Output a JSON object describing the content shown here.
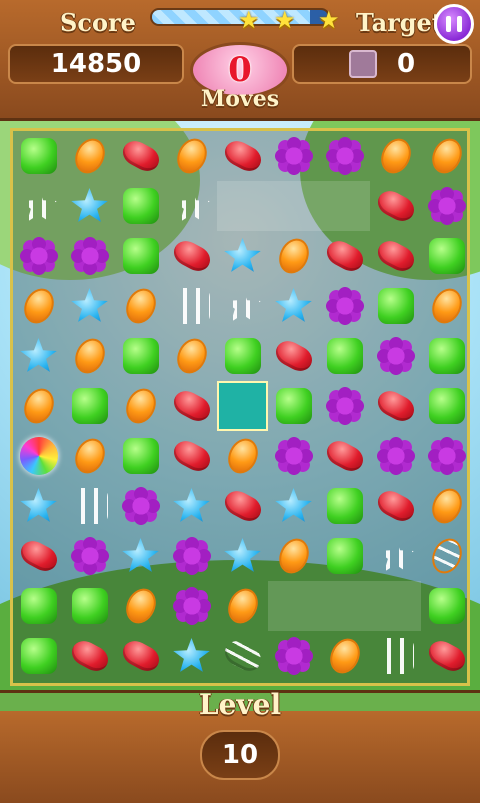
{
  "hud": {
    "score_label": "Score",
    "score_value": "14850",
    "target_label": "Target",
    "target_value": "0",
    "moves_value": "0",
    "moves_label": "Moves",
    "progress": 0.9,
    "stars_earned": 3
  },
  "level": {
    "label": "Level",
    "value": "10"
  },
  "board": {
    "columns": 9,
    "rows": 11,
    "grid": [
      [
        "green",
        "orange",
        "red",
        "orange",
        "red",
        "purple",
        "purple",
        "orange",
        "orange"
      ],
      [
        "blue-striped",
        "blue",
        "green",
        "blue-striped",
        "",
        "",
        "",
        "red",
        "purple"
      ],
      [
        "purple",
        "purple",
        "green",
        "red",
        "blue",
        "orange",
        "red",
        "red",
        "green"
      ],
      [
        "orange",
        "blue",
        "orange",
        "green-striped",
        "blue-striped",
        "blue",
        "purple",
        "green",
        "orange"
      ],
      [
        "blue",
        "orange",
        "green",
        "orange",
        "green",
        "red",
        "green",
        "purple",
        "green"
      ],
      [
        "orange",
        "green",
        "orange",
        "red",
        "selected",
        "green",
        "purple",
        "red",
        "green"
      ],
      [
        "rainbow",
        "orange",
        "green",
        "red",
        "orange",
        "purple",
        "red",
        "purple",
        "purple"
      ],
      [
        "blue",
        "green-striped",
        "purple",
        "blue",
        "red",
        "blue",
        "green",
        "red",
        "orange"
      ],
      [
        "red",
        "purple",
        "blue",
        "purple",
        "blue",
        "orange",
        "green",
        "blue-striped",
        "orange-striped"
      ],
      [
        "green",
        "green",
        "orange",
        "purple",
        "orange",
        "",
        "",
        "",
        "green"
      ],
      [
        "green",
        "red",
        "red",
        "blue",
        "red-striped",
        "purple",
        "orange",
        "green-striped",
        "red"
      ]
    ]
  }
}
